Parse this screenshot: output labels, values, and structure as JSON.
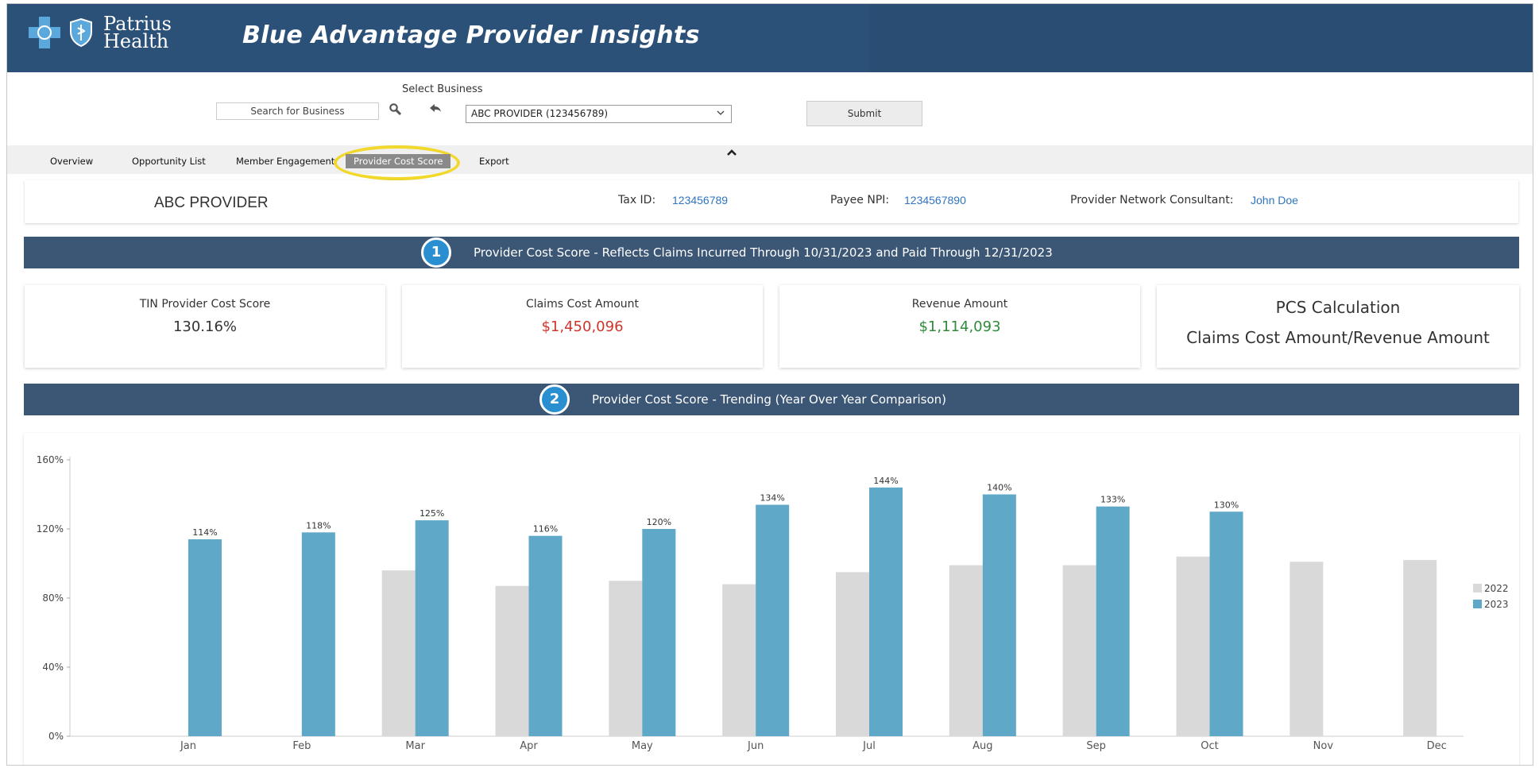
{
  "header": {
    "logo_text_line1": "Patrius",
    "logo_text_line2": "Health",
    "app_title": "Blue Advantage Provider Insights"
  },
  "business": {
    "caption": "Select Business",
    "search_text": "Search for Business",
    "selected": "ABC PROVIDER (123456789)",
    "submit_label": "Submit"
  },
  "tabs": [
    {
      "label": "Overview"
    },
    {
      "label": "Opportunity List"
    },
    {
      "label": "Member Engagement"
    },
    {
      "label": "Provider Cost Score",
      "active": true
    },
    {
      "label": "Export"
    }
  ],
  "provider": {
    "name": "ABC PROVIDER",
    "tax_id_label": "Tax ID:",
    "tax_id": "123456789",
    "npi_label": "Payee NPI:",
    "npi": "1234567890",
    "consultant_label": "Provider Network Consultant:",
    "consultant": "John Doe"
  },
  "section1": {
    "badge": "1",
    "title": "Provider Cost Score - Reflects Claims Incurred Through 10/31/2023 and Paid Through 12/31/2023"
  },
  "cards": {
    "tin_label": "TIN Provider Cost Score",
    "tin_value": "130.16%",
    "claims_label": "Claims Cost Amount",
    "claims_value": "$1,450,096",
    "revenue_label": "Revenue Amount",
    "revenue_value": "$1,114,093",
    "pcs_title": "PCS Calculation",
    "pcs_formula": "Claims Cost Amount/Revenue Amount"
  },
  "section2": {
    "badge": "2",
    "title": "Provider Cost Score - Trending (Year Over Year Comparison)"
  },
  "colors": {
    "header_bg": "#2c5178",
    "section_bg": "#3c5675",
    "claims_red": "#d0352b",
    "revenue_green": "#2e8b3a",
    "link_blue": "#2f74c0",
    "series_2022": "#d9d9d9",
    "series_2023": "#5fa8c8",
    "highlight_ring": "#f1d82a"
  },
  "chart_data": {
    "type": "bar",
    "categories": [
      "Jan",
      "Feb",
      "Mar",
      "Apr",
      "May",
      "Jun",
      "Jul",
      "Aug",
      "Sep",
      "Oct",
      "Nov",
      "Dec"
    ],
    "series": [
      {
        "name": "2022",
        "values": [
          null,
          null,
          96,
          87,
          90,
          88,
          95,
          99,
          99,
          104,
          101,
          102
        ]
      },
      {
        "name": "2023",
        "values": [
          114,
          118,
          125,
          116,
          120,
          134,
          144,
          140,
          133,
          130,
          null,
          null
        ]
      }
    ],
    "data_labels_2023": [
      "114%",
      "118%",
      "125%",
      "116%",
      "120%",
      "134%",
      "144%",
      "140%",
      "133%",
      "130%"
    ],
    "y_ticks": [
      "0%",
      "40%",
      "80%",
      "120%",
      "160%"
    ],
    "ylim": [
      0,
      160
    ],
    "legend_position": "right"
  }
}
